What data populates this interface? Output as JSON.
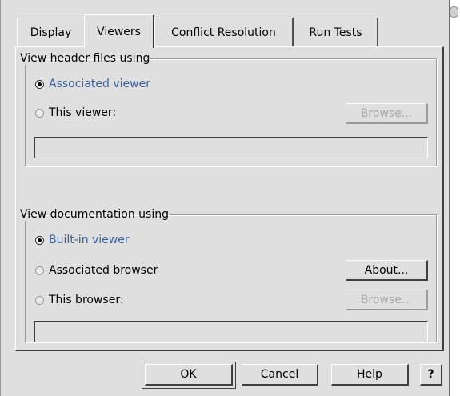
{
  "tabs": [
    {
      "label": "Display",
      "active": false
    },
    {
      "label": "Viewers",
      "active": true
    },
    {
      "label": "Conflict Resolution",
      "active": false
    },
    {
      "label": "Run Tests",
      "active": false
    }
  ],
  "header_group": {
    "title": "View header files using",
    "options": [
      {
        "label": "Associated viewer",
        "checked": true
      },
      {
        "label": "This viewer:",
        "checked": false
      }
    ],
    "browse_label": "Browse...",
    "path_value": ""
  },
  "doc_group": {
    "title": "View documentation using",
    "options": [
      {
        "label": "Built-in viewer",
        "checked": true
      },
      {
        "label": "Associated browser",
        "checked": false
      },
      {
        "label": "This browser:",
        "checked": false
      }
    ],
    "about_label": "About...",
    "browse_label": "Browse...",
    "path_value": ""
  },
  "buttons": {
    "ok": "OK",
    "cancel": "Cancel",
    "help": "Help",
    "question": "?"
  }
}
